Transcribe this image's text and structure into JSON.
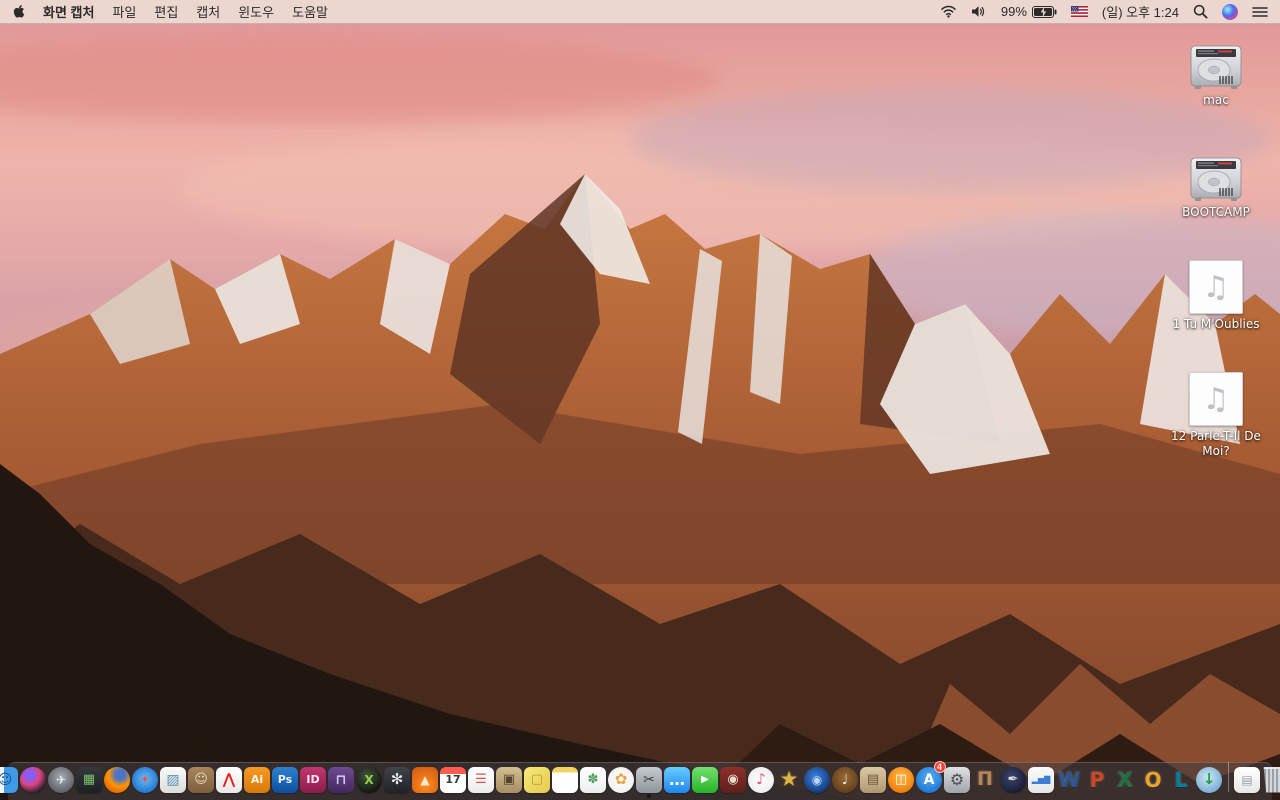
{
  "colors": {
    "menu_bar_bg": "#ecd6d0",
    "menu_text": "#2d2a2a",
    "dock_bg": "rgba(66,60,64,0.60)",
    "badge_red": "#ff3b30",
    "desktop_label_text": "#ffffff",
    "sky_top": "#e7a59e",
    "sky_lavender": "#a9a5bb",
    "mountain_sunlit": "#c97a42",
    "mountain_shadow": "#5f3524",
    "foreground_rock": "#221610"
  },
  "menu_bar": {
    "app_name": "화면 캡처",
    "menus": [
      "파일",
      "편집",
      "캡처",
      "윈도우",
      "도움말"
    ],
    "status": {
      "battery_percent": "99%",
      "clock": "(일) 오후 1:24"
    }
  },
  "desktop": {
    "audio_glyph": "♫",
    "icons": [
      {
        "id": "mac",
        "label": "mac",
        "type": "hard-drive"
      },
      {
        "id": "bootcamp",
        "label": "BOOTCAMP",
        "type": "hard-drive"
      },
      {
        "id": "tu-moublies",
        "label": "1 Tu M'Oublies",
        "type": "audio-file"
      },
      {
        "id": "parle-t-il-de-moi",
        "label": "12 Parle-T-Il De Moi?",
        "type": "audio-file"
      }
    ]
  },
  "dock": {
    "items": [
      {
        "name": "finder",
        "glyph": "☺",
        "bg": "linear-gradient(90deg,#f2f5f8 0 46%,#3f9ae8 46% 100%)",
        "fg": "#1c4f8c",
        "shape": "rounded",
        "fs": 14,
        "running": true
      },
      {
        "name": "siri",
        "glyph": "",
        "bg": "radial-gradient(circle at 38% 32%,#8a5cf6 0 18%,#e0457b 42%,#1b1b2e 78%)",
        "shape": "circle"
      },
      {
        "name": "launchpad",
        "glyph": "✈",
        "bg": "radial-gradient(circle at 50% 40%,#a8adb4,#585d64 78%)",
        "fg": "#eceff2",
        "shape": "circle",
        "fs": 12
      },
      {
        "name": "mission-control",
        "glyph": "▦",
        "bg": "linear-gradient(#34373c,#1e2024)",
        "fg": "#7ac56a",
        "shape": "rounded",
        "fs": 13
      },
      {
        "name": "firefox",
        "glyph": "",
        "bg": "radial-gradient(circle at 62% 30%,#4a74c9 0 20%,#ff9500 48%,#e05e00 82%)",
        "shape": "circle"
      },
      {
        "name": "safari",
        "glyph": "✦",
        "bg": "radial-gradient(circle at 50% 45%,#6db9f5,#1e72cf 78%)",
        "fg": "#ff4a3d",
        "shape": "circle",
        "fs": 11
      },
      {
        "name": "preview",
        "glyph": "▨",
        "bg": "linear-gradient(#fbfbf9,#dadcd8)",
        "fg": "#5a8fb8",
        "shape": "rounded",
        "fs": 14
      },
      {
        "name": "contacts",
        "glyph": "☺",
        "bg": "linear-gradient(#a8855c,#7c5f3c)",
        "fg": "#ead9b8",
        "shape": "rounded",
        "fs": 13
      },
      {
        "name": "acrobat-reader",
        "glyph": "⋀",
        "bg": "linear-gradient(#ffffff,#e8e8e8)",
        "fg": "#e2231a",
        "shape": "rounded",
        "fs": 15
      },
      {
        "name": "illustrator",
        "glyph": "Ai",
        "bg": "linear-gradient(#f59a23,#d87a0a)",
        "fg": "#fff7ea",
        "shape": "rounded",
        "fs": 11
      },
      {
        "name": "photoshop",
        "glyph": "Ps",
        "bg": "linear-gradient(#2f80d0,#0d4f9e)",
        "fg": "#eaf4ff",
        "shape": "rounded",
        "fs": 11
      },
      {
        "name": "indesign",
        "glyph": "ID",
        "bg": "linear-gradient(#c2386f,#8c1c4c)",
        "fg": "#ffe8f2",
        "shape": "rounded",
        "fs": 11
      },
      {
        "name": "toast-titanium",
        "glyph": "⊓",
        "bg": "linear-gradient(#6e4b92,#43275e)",
        "fg": "#d5c3ec",
        "shape": "rounded",
        "fs": 14
      },
      {
        "name": "xld",
        "glyph": "X",
        "bg": "radial-gradient(circle at 42% 35%,#46543f,#0d110c 80%)",
        "fg": "#8ed44a",
        "shape": "circle",
        "fs": 12
      },
      {
        "name": "macs-fan-control",
        "glyph": "✻",
        "bg": "linear-gradient(#40444b,#202227)",
        "fg": "#e8ecf0",
        "shape": "rounded",
        "fs": 15
      },
      {
        "name": "vlc",
        "glyph": "▲",
        "bg": "radial-gradient(circle at 50% 68%,#ff8e1f,#d85f14 82%)",
        "fg": "#ffe9d2",
        "shape": "rounded",
        "fs": 12
      },
      {
        "name": "calendar",
        "glyph": "17",
        "bg": "linear-gradient(#ff5b51 0 26%,#ffffff 26%)",
        "fg": "#33373c",
        "shape": "rounded",
        "fs": 11
      },
      {
        "name": "reminders",
        "glyph": "☰",
        "bg": "linear-gradient(#ffffff,#ececec)",
        "fg": "#d95450",
        "shape": "rounded",
        "fs": 13
      },
      {
        "name": "stuffit-expander",
        "glyph": "▣",
        "bg": "linear-gradient(#d3bd92,#a98f63)",
        "fg": "#54452c",
        "shape": "rounded",
        "fs": 13
      },
      {
        "name": "stickies",
        "glyph": "▢",
        "bg": "linear-gradient(135deg,#f9e97a,#e5c94e)",
        "fg": "#b49a2e",
        "shape": "rounded",
        "fs": 13
      },
      {
        "name": "notes",
        "glyph": "",
        "bg": "linear-gradient(#f3d364 0 22%,#ffffff 22%)",
        "shape": "rounded"
      },
      {
        "name": "templates",
        "glyph": "✽",
        "bg": "linear-gradient(#ffffff,#eceff1)",
        "fg": "#4d9e57",
        "shape": "rounded",
        "fs": 13
      },
      {
        "name": "photos",
        "glyph": "✿",
        "bg": "radial-gradient(circle,#ffffff,#ececec)",
        "fg": "#f2a03d",
        "shape": "circle",
        "fs": 15
      },
      {
        "name": "grab",
        "glyph": "✂",
        "bg": "linear-gradient(#c6cad0,#8f959c)",
        "fg": "#3a3e44",
        "shape": "rounded",
        "fs": 14,
        "running": true
      },
      {
        "name": "messages",
        "glyph": "…",
        "bg": "linear-gradient(#66ccff,#1e87f0)",
        "fg": "#ffffff",
        "shape": "rounded",
        "fs": 16
      },
      {
        "name": "facetime",
        "glyph": "▶",
        "bg": "linear-gradient(#72e06e,#28b32a)",
        "fg": "#ffffff",
        "shape": "rounded",
        "fs": 10
      },
      {
        "name": "photo-booth",
        "glyph": "◉",
        "bg": "linear-gradient(#8e2f2a,#5f1f1c)",
        "fg": "#e8ddcc",
        "shape": "rounded",
        "fs": 13
      },
      {
        "name": "itunes",
        "glyph": "♪",
        "bg": "radial-gradient(circle,#ffffff,#e8e8e8)",
        "fg": "#e84f8b",
        "shape": "circle",
        "fs": 15
      },
      {
        "name": "star-app",
        "glyph": "★",
        "bg": "transparent",
        "fg": "#e0b33c",
        "shape": "plain",
        "fs": 21
      },
      {
        "name": "bluray-player",
        "glyph": "◉",
        "bg": "radial-gradient(circle at 45% 40%,#3a85e0,#12306e 82%)",
        "fg": "#bcd8ff",
        "shape": "circle",
        "fs": 12
      },
      {
        "name": "garageband",
        "glyph": "♩",
        "bg": "radial-gradient(circle at 50% 40%,#9a6a3a,#5c3a18 82%)",
        "fg": "#f2e2c8",
        "shape": "circle",
        "fs": 14
      },
      {
        "name": "collage",
        "glyph": "▤",
        "bg": "linear-gradient(#d9c9a2,#b29771)",
        "fg": "#6b5838",
        "shape": "rounded",
        "fs": 13
      },
      {
        "name": "ibooks",
        "glyph": "◫",
        "bg": "radial-gradient(circle at 50% 38%,#ffb84d,#f07800 82%)",
        "fg": "#ffffff",
        "shape": "circle",
        "fs": 13
      },
      {
        "name": "app-store",
        "glyph": "A",
        "bg": "radial-gradient(circle at 50% 38%,#55b0f2,#1b72d0 82%)",
        "fg": "#ffffff",
        "shape": "circle",
        "fs": 14,
        "badge": "4"
      },
      {
        "name": "system-preferences",
        "glyph": "⚙",
        "bg": "linear-gradient(#dfe1e3,#9fa4aa)",
        "fg": "#4c5055",
        "shape": "rounded",
        "fs": 16
      },
      {
        "name": "keynote",
        "glyph": "Π",
        "bg": "transparent",
        "fg": "#b98652",
        "shape": "plain",
        "fs": 19
      },
      {
        "name": "pages",
        "glyph": "✒",
        "bg": "radial-gradient(circle at 42% 38%,#3d4668,#141830 82%)",
        "fg": "#d8dcec",
        "shape": "circle",
        "fs": 13
      },
      {
        "name": "numbers",
        "glyph": "▂▅▇",
        "bg": "linear-gradient(#fafafa,#e4e6e8)",
        "fg": "#3a7bd5",
        "shape": "rounded",
        "fs": 8
      },
      {
        "name": "word",
        "glyph": "W",
        "bg": "transparent",
        "fg": "#2b579a",
        "shape": "plain",
        "fs": 20
      },
      {
        "name": "powerpoint",
        "glyph": "P",
        "bg": "transparent",
        "fg": "#d14524",
        "shape": "plain",
        "fs": 20
      },
      {
        "name": "excel",
        "glyph": "X",
        "bg": "transparent",
        "fg": "#1e7145",
        "shape": "plain",
        "fs": 20
      },
      {
        "name": "outlook",
        "glyph": "O",
        "bg": "transparent",
        "fg": "#eaa327",
        "shape": "plain",
        "fs": 20
      },
      {
        "name": "lync",
        "glyph": "L",
        "bg": "transparent",
        "fg": "#00809d",
        "shape": "plain",
        "fs": 20
      },
      {
        "name": "downloader",
        "glyph": "↓",
        "bg": "radial-gradient(circle at 45% 40%,#cfe6f5,#6fa8cf 82%)",
        "fg": "#1f9d3c",
        "shape": "circle",
        "fs": 15
      },
      {
        "divider": true
      },
      {
        "name": "document",
        "glyph": "▤",
        "bg": "linear-gradient(#ffffff,#e8e8e8)",
        "fg": "#9aa0a6",
        "shape": "rounded",
        "fs": 12
      },
      {
        "name": "trash",
        "glyph": "",
        "bg": "repeating-linear-gradient(90deg,#d4d8dc 0 2px,#9aa0a6 2px 4px)",
        "shape": "trash"
      }
    ]
  }
}
